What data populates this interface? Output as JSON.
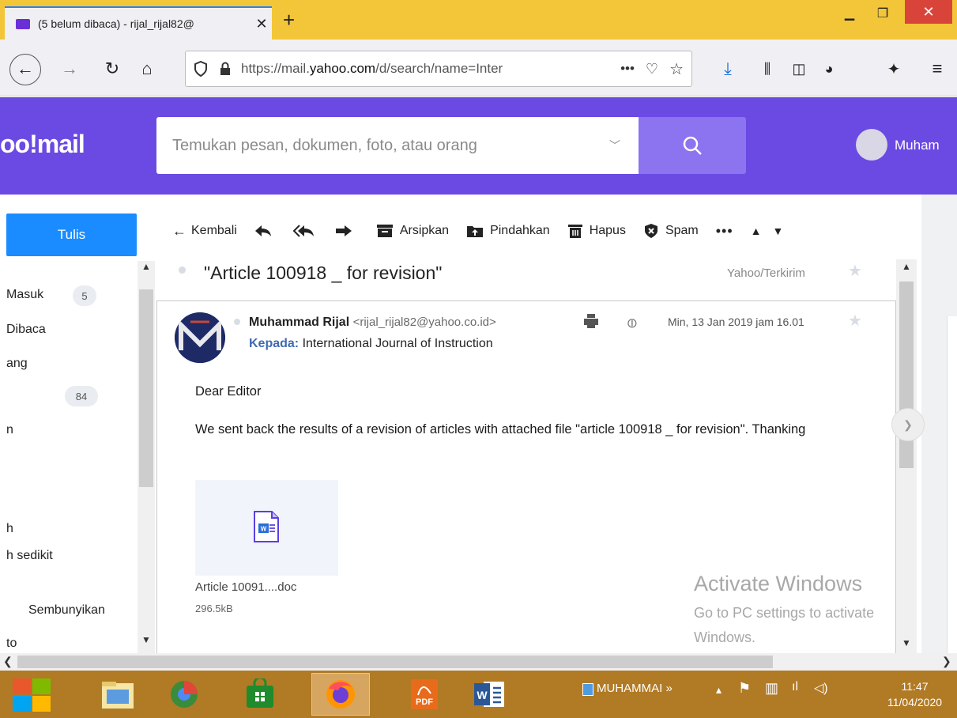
{
  "browser": {
    "tab_title": "(5 belum dibaca) - rijal_rijal82@",
    "url_prefix": "https://mail.",
    "url_domain": "yahoo.com",
    "url_rest": "/d/search/name=Inter",
    "url_more": "•••"
  },
  "header": {
    "logo_a": "oo!",
    "logo_b": "mail",
    "search_placeholder": "Temukan pesan, dokumen, foto, atau orang",
    "user_name": "Muham"
  },
  "sidebar": {
    "compose_label": "Tulis",
    "items": [
      {
        "label": "Masuk",
        "badge": "5"
      },
      {
        "label": "Dibaca",
        "badge": ""
      },
      {
        "label": "ang",
        "badge": ""
      },
      {
        "label": "",
        "badge": "84"
      },
      {
        "label": "n",
        "badge": ""
      },
      {
        "label": "h",
        "badge": ""
      },
      {
        "label": "h sedikit",
        "badge": ""
      },
      {
        "label": "Sembunyikan",
        "badge": ""
      },
      {
        "label": "to",
        "badge": ""
      }
    ]
  },
  "toolbar": {
    "back_label": "Kembali",
    "archive_label": "Arsipkan",
    "move_label": "Pindahkan",
    "delete_label": "Hapus",
    "spam_label": "Spam"
  },
  "message": {
    "subject": "\"Article 100918 _ for revision\"",
    "folder": "Yahoo/Terkirim",
    "sender_name": "Muhammad Rijal",
    "sender_email": "<rijal_rijal82@yahoo.co.id>",
    "to_label": "Kepada:",
    "to_value": "International Journal of Instruction",
    "date": "Min, 13 Jan 2019 jam 16.01",
    "greeting": "Dear Editor",
    "body": "We sent back the results of a revision of articles with attached file \"article 100918 _ for revision\". Thanking",
    "attachment_name": "Article 10091....doc",
    "attachment_size": "296.5kB"
  },
  "watermark": {
    "title": "Activate Windows",
    "line1": "Go to PC settings to activate",
    "line2": "Windows."
  },
  "taskbar": {
    "window_label": "MUHAMMAI",
    "time": "11:47",
    "date": "11/04/2020"
  },
  "colors": {
    "yahoo_purple": "#6b4ae3",
    "compose_blue": "#1a8cff",
    "titlebar_gold": "#f3c63a",
    "taskbar_brown": "#b17a25"
  }
}
